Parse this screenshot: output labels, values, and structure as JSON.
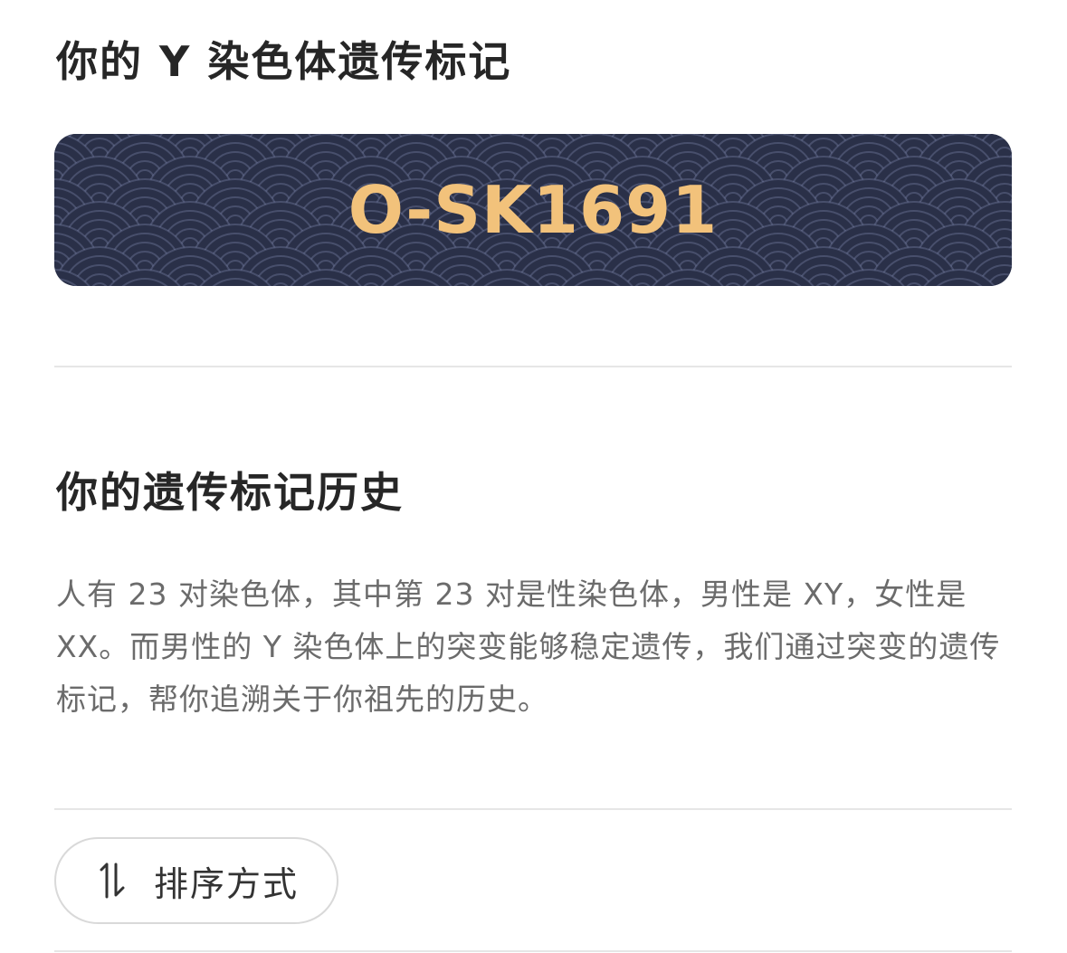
{
  "y_marker_section": {
    "title": "你的 Y 染色体遗传标记",
    "marker_code": "O-SK1691",
    "colors": {
      "card_top": "#22263a",
      "card_bottom": "#3a4262",
      "code_text": "#f2c27b"
    }
  },
  "history_section": {
    "title": "你的遗传标记历史",
    "description": "人有 23 对染色体，其中第 23 对是性染色体，男性是 XY，女性是 XX。而男性的 Y 染色体上的突变能够稳定遗传，我们通过突变的遗传标记，帮你追溯关于你祖先的历史。"
  },
  "sort": {
    "label": "排序方式",
    "icon": "sort-arrows-icon"
  }
}
